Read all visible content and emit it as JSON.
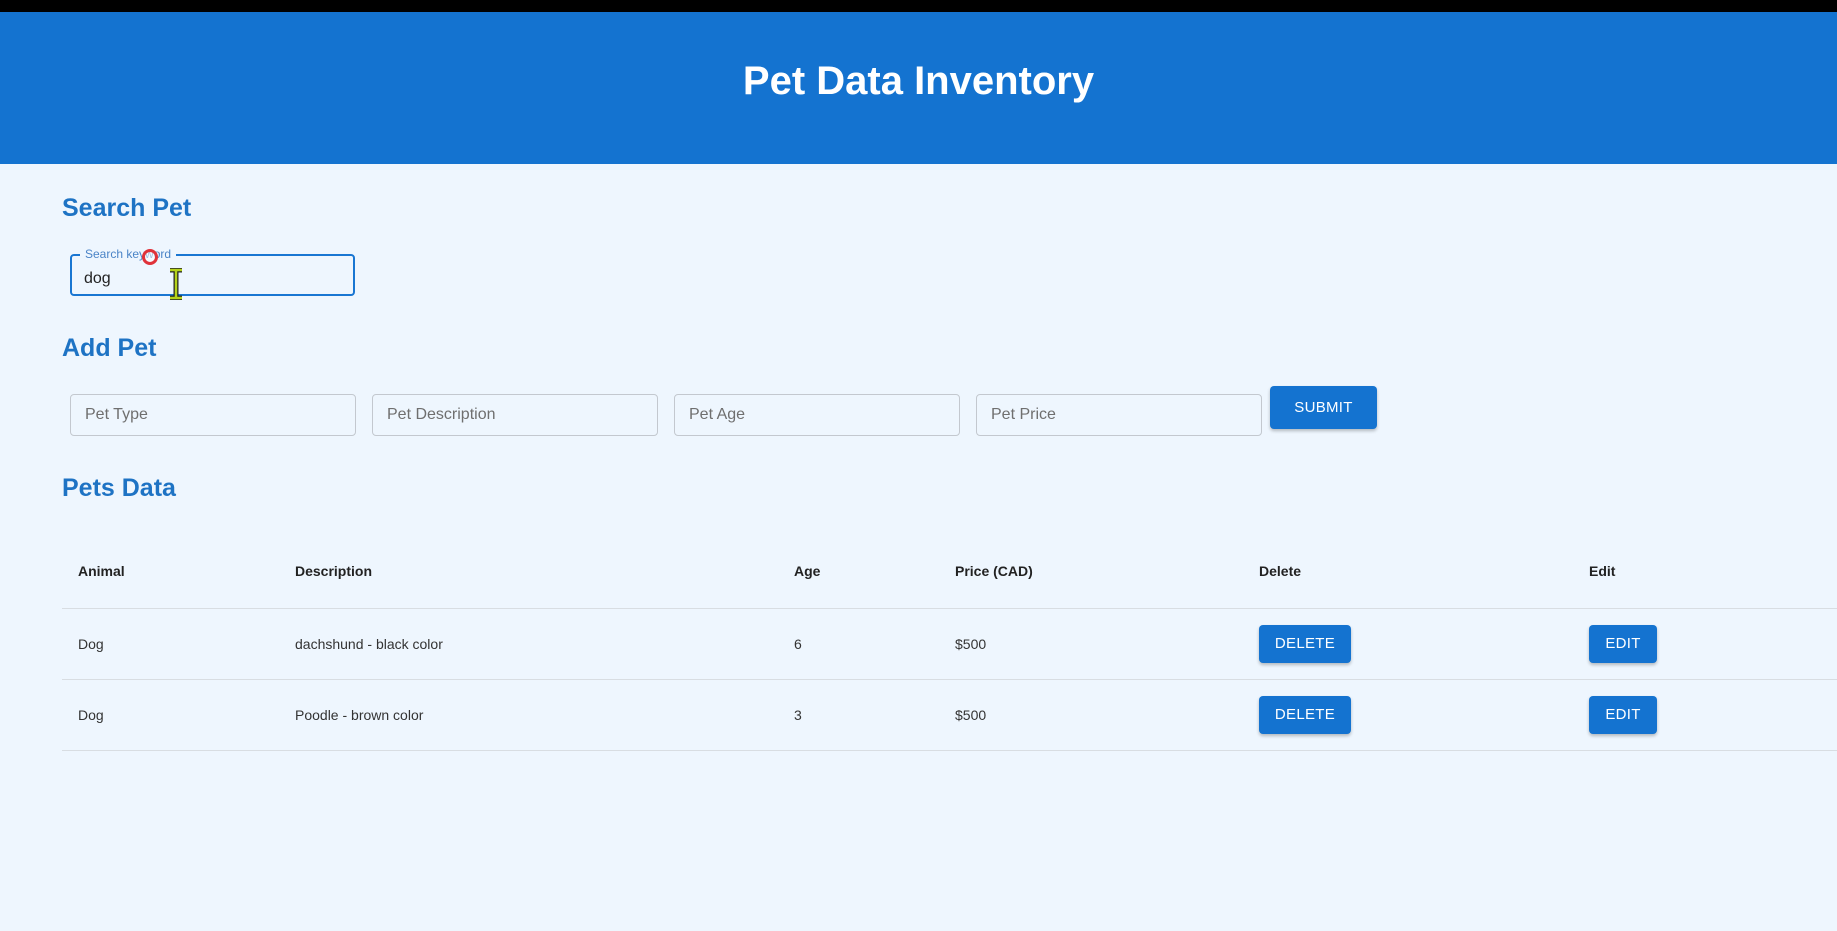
{
  "header": {
    "title": "Pet Data Inventory"
  },
  "search": {
    "title": "Search Pet",
    "label": "Search keyword",
    "value": "dog"
  },
  "add": {
    "title": "Add Pet",
    "fields": [
      {
        "placeholder": "Pet Type",
        "value": ""
      },
      {
        "placeholder": "Pet Description",
        "value": ""
      },
      {
        "placeholder": "Pet Age",
        "value": ""
      },
      {
        "placeholder": "Pet Price",
        "value": ""
      }
    ],
    "submit_label": "SUBMIT"
  },
  "table": {
    "title": "Pets Data",
    "columns": [
      "Animal",
      "Description",
      "Age",
      "Price (CAD)",
      "Delete",
      "Edit"
    ],
    "rows": [
      {
        "animal": "Dog",
        "description": "dachshund - black color",
        "age": "6",
        "price": "$500",
        "delete_label": "DELETE",
        "edit_label": "EDIT"
      },
      {
        "animal": "Dog",
        "description": "Poodle - brown color",
        "age": "3",
        "price": "$500",
        "delete_label": "DELETE",
        "edit_label": "EDIT"
      }
    ]
  },
  "colors": {
    "primary": "#1473d0",
    "heading": "#1e73c4",
    "background": "#eef6fe"
  }
}
